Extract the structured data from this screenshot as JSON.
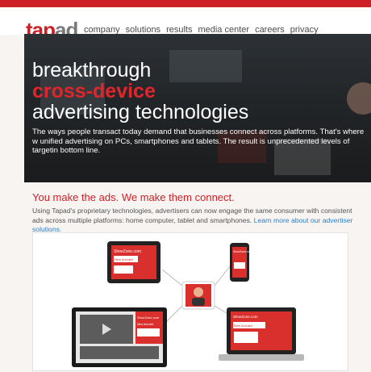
{
  "brand": {
    "part1": "tap",
    "part2": "ad"
  },
  "nav": {
    "items": [
      "company",
      "solutions",
      "results",
      "media center",
      "careers",
      "privacy"
    ]
  },
  "hero": {
    "line1": "breakthrough",
    "line2": "cross-device",
    "line3": "advertising technologies",
    "description": "The ways people transact today demand that businesses connect across platforms. That's where w unified advertising on PCs, smartphones and tablets. The result is unprecedented levels of targetin bottom line."
  },
  "section": {
    "title": "You make the ads. We make them connect.",
    "text": "Using Tapad's proprietary technologies, advertisers can now engage the same consumer with consistent ads across multiple platforms: home computer, tablet and smartphones.",
    "link": "Learn more about our advertiser solutions."
  },
  "diagram": {
    "ad_brand": "ShoeZone.com",
    "ad_tag": "New Arrivals!"
  },
  "colors": {
    "accent": "#cf1f26",
    "link": "#2b7fc6"
  }
}
